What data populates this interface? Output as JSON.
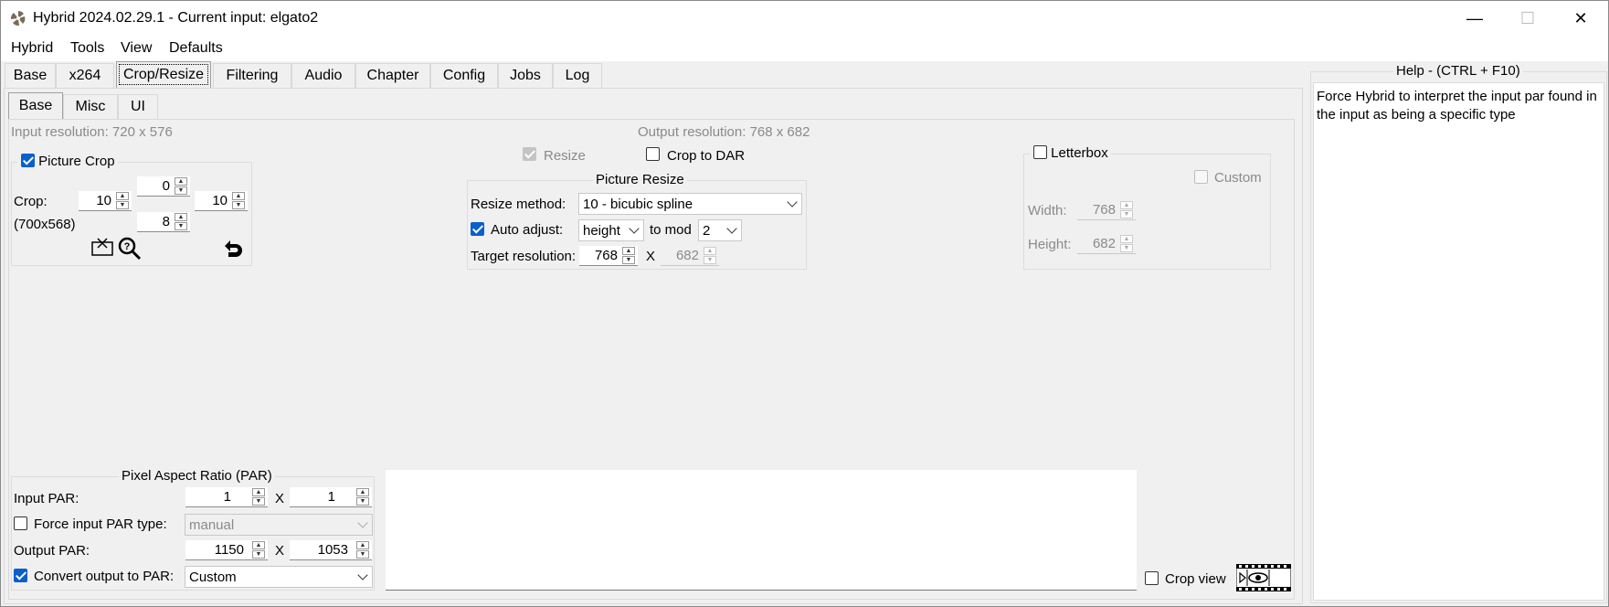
{
  "window": {
    "title": "Hybrid 2024.02.29.1 - Current input: elgato2",
    "minimize": "—",
    "maximize": "☐",
    "close": "✕"
  },
  "menu": [
    "Hybrid",
    "Tools",
    "View",
    "Defaults"
  ],
  "main_tabs": [
    "Base",
    "x264",
    "Crop/Resize",
    "Filtering",
    "Audio",
    "Chapter",
    "Config",
    "Jobs",
    "Log"
  ],
  "selected_main_tab": "Crop/Resize",
  "sub_tabs": [
    "Base",
    "Misc",
    "UI"
  ],
  "input_resolution": "Input resolution: 720 x 576",
  "output_resolution": "Output resolution: 768 x 682",
  "picture_crop": {
    "label": "Picture Crop",
    "checked": true,
    "crop_label": "Crop:",
    "size_label": "(700x568)",
    "top": "0",
    "left": "10",
    "right": "10",
    "bottom": "8"
  },
  "resize_check": {
    "label": "Resize",
    "checked": true,
    "disabled": true
  },
  "crop_to_dar": {
    "label": "Crop to DAR",
    "checked": false
  },
  "picture_resize": {
    "title": "Picture Resize",
    "method_label": "Resize method:",
    "method_value": "10 - bicubic spline",
    "auto_adjust_label": "Auto adjust:",
    "auto_adjust_checked": true,
    "auto_adjust_value": "height",
    "to_mod_label": "to mod",
    "mod_value": "2",
    "target_label": "Target resolution:",
    "target_w": "768",
    "x": "X",
    "target_h": "682"
  },
  "letterbox": {
    "label": "Letterbox",
    "checked": false,
    "custom_label": "Custom",
    "width_label": "Width:",
    "width_value": "768",
    "height_label": "Height:",
    "height_value": "682"
  },
  "par": {
    "title": "Pixel Aspect Ratio (PAR)",
    "input_label": "Input PAR:",
    "input_a": "1",
    "input_b": "1",
    "x": "X",
    "force_label": "Force input PAR type:",
    "force_checked": false,
    "force_value": "manual",
    "output_label": "Output PAR:",
    "output_a": "1150",
    "output_b": "1053",
    "convert_label": "Convert output to PAR:",
    "convert_checked": true,
    "convert_value": "Custom"
  },
  "crop_view": {
    "label": "Crop view",
    "checked": false
  },
  "help": {
    "title": "Help - (CTRL + F10)",
    "text": "Force Hybrid to interpret the input par found in the input as being a specific type"
  }
}
